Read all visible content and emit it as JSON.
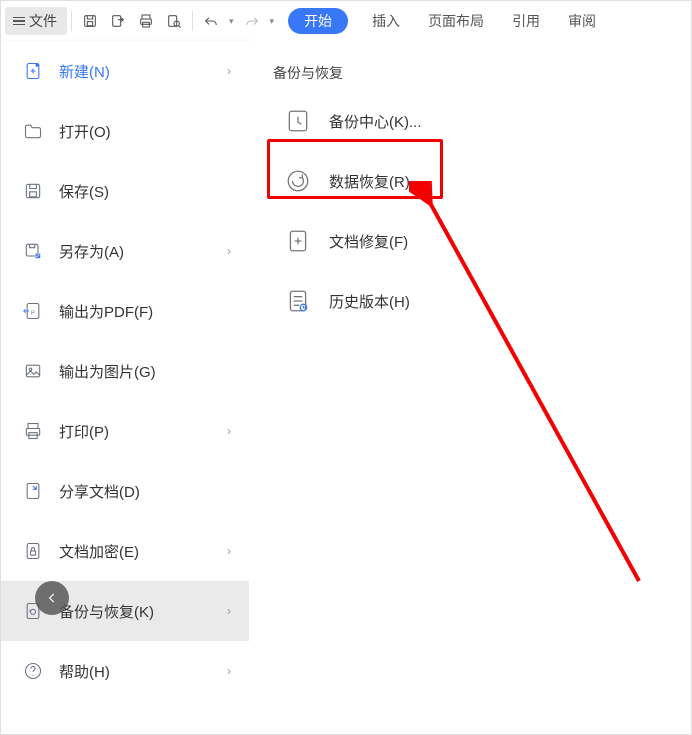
{
  "toolbar": {
    "file_label": "文件",
    "start_label": "开始",
    "tabs": [
      "插入",
      "页面布局",
      "引用",
      "审阅"
    ]
  },
  "sidemenu": {
    "items": [
      {
        "label": "新建(N)"
      },
      {
        "label": "打开(O)"
      },
      {
        "label": "保存(S)"
      },
      {
        "label": "另存为(A)"
      },
      {
        "label": "输出为PDF(F)"
      },
      {
        "label": "输出为图片(G)"
      },
      {
        "label": "打印(P)"
      },
      {
        "label": "分享文档(D)"
      },
      {
        "label": "文档加密(E)"
      },
      {
        "label": "备份与恢复(K)"
      },
      {
        "label": "帮助(H)"
      }
    ]
  },
  "panel": {
    "title": "备份与恢复",
    "items": [
      {
        "label": "备份中心(K)..."
      },
      {
        "label": "数据恢复(R)"
      },
      {
        "label": "文档修复(F)"
      },
      {
        "label": "历史版本(H)"
      }
    ]
  }
}
